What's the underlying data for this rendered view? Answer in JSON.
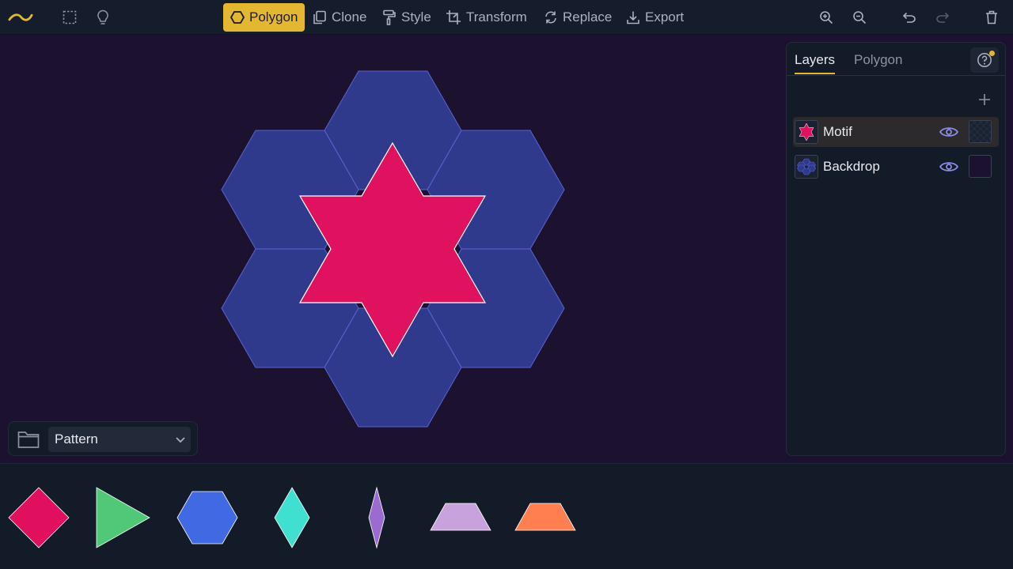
{
  "toolbar": {
    "tools": [
      {
        "label": "Polygon",
        "icon": "hexagon-outline-icon",
        "active": true
      },
      {
        "label": "Clone",
        "icon": "clone-icon",
        "active": false
      },
      {
        "label": "Style",
        "icon": "paint-roller-icon",
        "active": false
      },
      {
        "label": "Transform",
        "icon": "transform-icon",
        "active": false
      },
      {
        "label": "Replace",
        "icon": "replace-icon",
        "active": false
      },
      {
        "label": "Export",
        "icon": "download-icon",
        "active": false
      }
    ],
    "left_icons": [
      "logo-icon",
      "select-marquee-icon",
      "lightbulb-icon"
    ],
    "right_icons": [
      "zoom-in-icon",
      "zoom-out-icon",
      "undo-icon",
      "redo-icon",
      "trash-icon"
    ]
  },
  "panel": {
    "tabs": [
      {
        "label": "Layers",
        "active": true
      },
      {
        "label": "Polygon",
        "active": false
      }
    ],
    "layers": [
      {
        "name": "Motif",
        "selected": true,
        "visible": true,
        "thumb_icon": "star-icon",
        "swatch": "transparent"
      },
      {
        "name": "Backdrop",
        "selected": false,
        "visible": true,
        "thumb_icon": "hexagon-cluster-icon",
        "swatch": "#1c1230"
      }
    ]
  },
  "project": {
    "selected": "Pattern"
  },
  "palette": [
    {
      "shape": "square-diamond",
      "color": "#e0105f"
    },
    {
      "shape": "triangle",
      "color": "#50c878"
    },
    {
      "shape": "hexagon",
      "color": "#4169e1"
    },
    {
      "shape": "rhombus-wide",
      "color": "#40e0d0"
    },
    {
      "shape": "rhombus-thin",
      "color": "#9b6bcf"
    },
    {
      "shape": "trapezoid",
      "color": "#c8a2dc"
    },
    {
      "shape": "trapezoid",
      "color": "#ff7f50"
    }
  ],
  "colors": {
    "accent": "#e4b733",
    "canvas": "#1c1230",
    "hexagon_fill": "#303a8c",
    "star_fill": "#e0115f"
  }
}
